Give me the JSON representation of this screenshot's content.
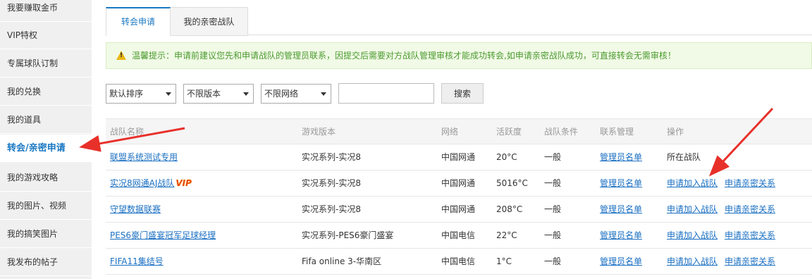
{
  "sidebar": {
    "items": [
      {
        "label": "我要赚取金币"
      },
      {
        "label": "VIP特权"
      },
      {
        "label": "专属球队订制"
      },
      {
        "label": "我的兑换"
      },
      {
        "label": "我的道具"
      },
      {
        "label": "转会/亲密申请"
      },
      {
        "label": "我的游戏攻略"
      },
      {
        "label": "我的图片、视频"
      },
      {
        "label": "我的搞笑图片"
      },
      {
        "label": "我发布的帖子"
      }
    ],
    "active_index": 5
  },
  "tabs": [
    {
      "label": "转会申请"
    },
    {
      "label": "我的亲密战队"
    }
  ],
  "notice": {
    "icon": "warning-icon",
    "text": "温馨提示：申请前建议您先和申请战队的管理员联系，因提交后需要对方战队管理审核才能成功转会,如申请亲密战队成功，可直接转会无需审核！"
  },
  "filters": {
    "sort": "默认排序",
    "version": "不限版本",
    "network": "不限网络",
    "search_value": "",
    "search_button": "搜索"
  },
  "table": {
    "headers": [
      "战队名称",
      "游戏版本",
      "网络",
      "活跃度",
      "战队条件",
      "联系管理",
      "操作"
    ],
    "vip_badge": "VIP",
    "rows": [
      {
        "name": "联盟系统测试专用",
        "vip": false,
        "version": "实况系列-实况8",
        "network": "中国网通",
        "activity": "20°C",
        "condition": "一般",
        "contact": "管理员名单",
        "action1": "所在战队",
        "action1_link": false,
        "action2": ""
      },
      {
        "name": "实况8网通AJ战队",
        "vip": true,
        "version": "实况系列-实况8",
        "network": "中国网通",
        "activity": "5016°C",
        "condition": "一般",
        "contact": "管理员名单",
        "action1": "申请加入战队",
        "action1_link": true,
        "action2": "申请亲密关系"
      },
      {
        "name": "守望数据联赛",
        "vip": false,
        "version": "实况系列-实况8",
        "network": "中国网通",
        "activity": "208°C",
        "condition": "一般",
        "contact": "管理员名单",
        "action1": "申请加入战队",
        "action1_link": true,
        "action2": "申请亲密关系"
      },
      {
        "name": "PES6豪门盛宴冠军足球经理",
        "vip": false,
        "version": "实况系列-PES6豪门盛宴",
        "network": "中国电信",
        "activity": "22°C",
        "condition": "一般",
        "contact": "管理员名单",
        "action1": "申请加入战队",
        "action1_link": true,
        "action2": "申请亲密关系"
      },
      {
        "name": "FIFA11集结号",
        "vip": false,
        "version": "Fifa online 3-华南区",
        "network": "中国电信",
        "activity": "1°C",
        "condition": "一般",
        "contact": "管理员名单",
        "action1": "申请加入战队",
        "action1_link": true,
        "action2": "申请亲密关系"
      }
    ]
  },
  "colors": {
    "accent": "#1a78c2",
    "link": "#1a6fc2",
    "notice_text": "#4b9a2f",
    "annotation_arrow": "#e8302a"
  }
}
